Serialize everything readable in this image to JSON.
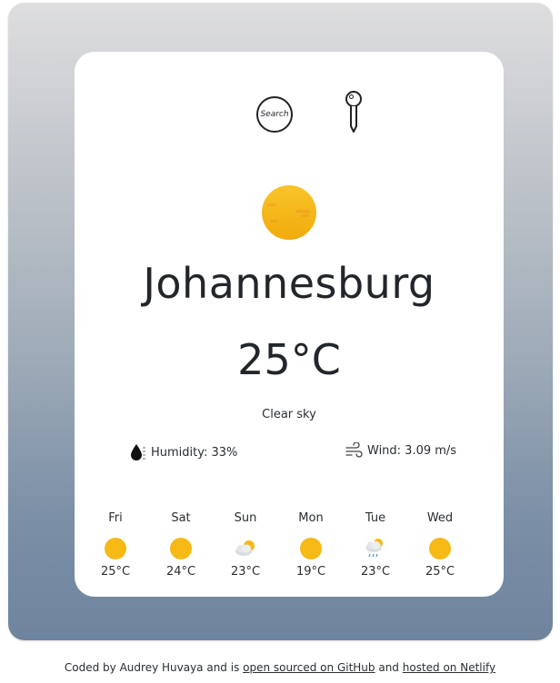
{
  "search": {
    "label": "Search"
  },
  "current": {
    "city": "Johannesburg",
    "temperature": "25°C",
    "description": "Clear sky",
    "icon": "clear-sky-sun-icon",
    "humidity_label": "Humidity: 33%",
    "wind_label": "Wind: 3.09 m/s"
  },
  "forecast": [
    {
      "day": "Fri",
      "temp": "25°C",
      "icon": "sun-icon"
    },
    {
      "day": "Sat",
      "temp": "24°C",
      "icon": "sun-icon"
    },
    {
      "day": "Sun",
      "temp": "23°C",
      "icon": "partly-cloudy-icon"
    },
    {
      "day": "Mon",
      "temp": "19°C",
      "icon": "sun-icon"
    },
    {
      "day": "Tue",
      "temp": "23°C",
      "icon": "cloud-rain-sun-icon"
    },
    {
      "day": "Wed",
      "temp": "25°C",
      "icon": "sun-icon"
    }
  ],
  "footer": {
    "prefix": "Coded by Audrey Huvaya and is ",
    "github_link": "open sourced on GitHub",
    "middle": " and ",
    "netlify_link": "hosted on Netlify"
  },
  "colors": {
    "sun": "#f6b916",
    "frame_top": "#dededf",
    "frame_bottom": "#6e849e",
    "card": "#ffffff"
  }
}
